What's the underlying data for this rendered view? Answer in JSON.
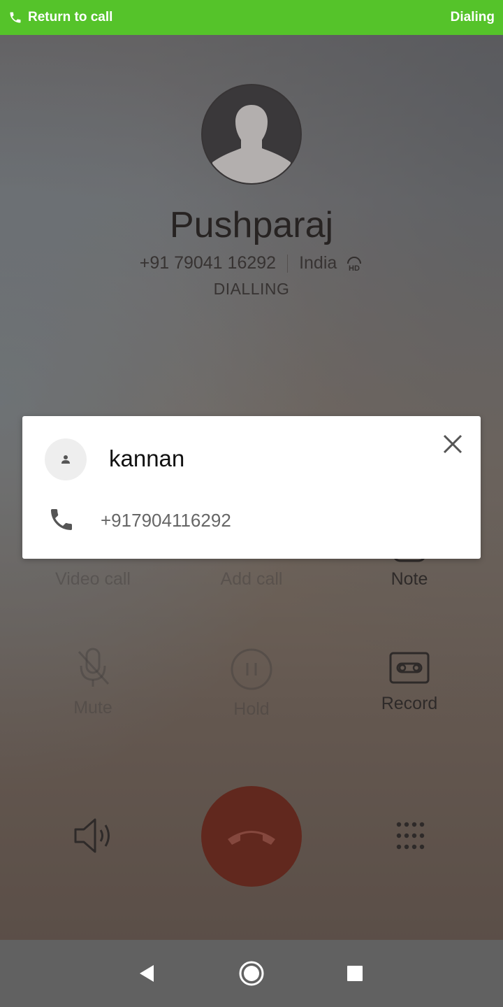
{
  "status_bar": {
    "return_label": "Return to call",
    "state_label": "Dialing",
    "color": "#55c32a"
  },
  "caller": {
    "name": "Pushparaj",
    "number": "+91 79041 16292",
    "location": "India",
    "status": "DIALLING"
  },
  "controls": [
    {
      "label": "Video call",
      "icon": "video-camera-icon",
      "enabled": false
    },
    {
      "label": "Add call",
      "icon": "add-call-icon",
      "enabled": false
    },
    {
      "label": "Note",
      "icon": "note-icon",
      "enabled": true
    },
    {
      "label": "Mute",
      "icon": "mic-off-icon",
      "enabled": false
    },
    {
      "label": "Hold",
      "icon": "pause-icon",
      "enabled": false
    },
    {
      "label": "Record",
      "icon": "record-icon",
      "enabled": true
    }
  ],
  "end_call": {
    "icon": "end-call-icon",
    "color": "#6b1a0c"
  },
  "contact_popup": {
    "contact_name": "kannan",
    "contact_number": "+917904116292"
  },
  "nav": {
    "back": "back-icon",
    "home": "home-icon",
    "recents": "recents-icon"
  }
}
